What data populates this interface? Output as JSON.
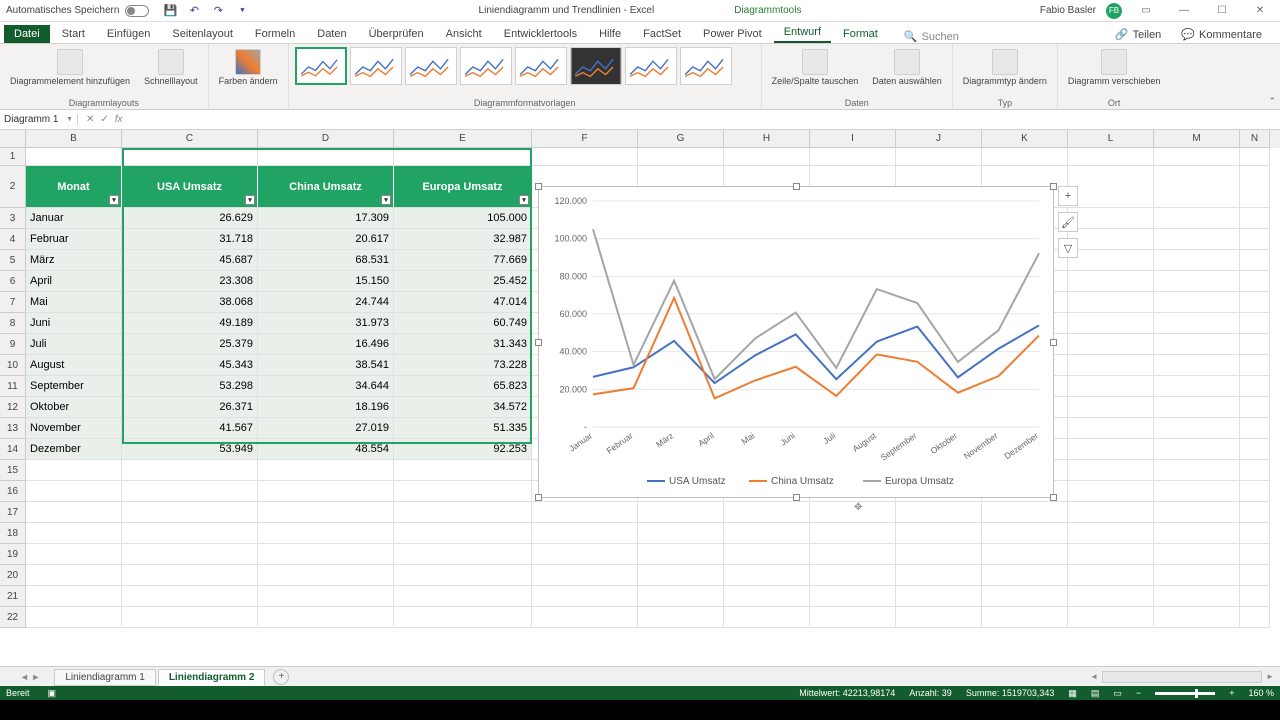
{
  "titlebar": {
    "autosave": "Automatisches Speichern",
    "doc_title": "Liniendiagramm und Trendlinien - Excel",
    "context_tools": "Diagrammtools",
    "user": "Fabio Basler",
    "user_initials": "FB"
  },
  "tabs": {
    "file": "Datei",
    "items": [
      "Start",
      "Einfügen",
      "Seitenlayout",
      "Formeln",
      "Daten",
      "Überprüfen",
      "Ansicht",
      "Entwicklertools",
      "Hilfe",
      "FactSet",
      "Power Pivot"
    ],
    "context": [
      "Entwurf",
      "Format"
    ],
    "active": "Entwurf",
    "search_placeholder": "Suchen",
    "share": "Teilen",
    "comments": "Kommentare"
  },
  "ribbon": {
    "g1": {
      "btn1": "Diagrammelement hinzufügen",
      "btn2": "Schnelllayout",
      "label": "Diagrammlayouts"
    },
    "g2": {
      "btn1": "Farben ändern"
    },
    "g3": {
      "label": "Diagrammformatvorlagen"
    },
    "g4": {
      "btn1": "Zeile/Spalte tauschen",
      "btn2": "Daten auswählen",
      "label": "Daten"
    },
    "g5": {
      "btn1": "Diagrammtyp ändern",
      "label": "Typ"
    },
    "g6": {
      "btn1": "Diagramm verschieben",
      "label": "Ort"
    }
  },
  "namebox": "Diagramm 1",
  "columns": [
    "B",
    "C",
    "D",
    "E",
    "F",
    "G",
    "H",
    "I",
    "J",
    "K",
    "L",
    "M",
    "N"
  ],
  "table": {
    "headers": [
      "Monat",
      "USA Umsatz",
      "China Umsatz",
      "Europa Umsatz"
    ],
    "rows": [
      [
        "Januar",
        "26.629",
        "17.309",
        "105.000"
      ],
      [
        "Februar",
        "31.718",
        "20.617",
        "32.987"
      ],
      [
        "März",
        "45.687",
        "68.531",
        "77.669"
      ],
      [
        "April",
        "23.308",
        "15.150",
        "25.452"
      ],
      [
        "Mai",
        "38.068",
        "24.744",
        "47.014"
      ],
      [
        "Juni",
        "49.189",
        "31.973",
        "60.749"
      ],
      [
        "Juli",
        "25.379",
        "16.496",
        "31.343"
      ],
      [
        "August",
        "45.343",
        "38.541",
        "73.228"
      ],
      [
        "September",
        "53.298",
        "34.644",
        "65.823"
      ],
      [
        "Oktober",
        "26.371",
        "18.196",
        "34.572"
      ],
      [
        "November",
        "41.567",
        "27.019",
        "51.335"
      ],
      [
        "Dezember",
        "53.949",
        "48.554",
        "92.253"
      ]
    ]
  },
  "chart_data": {
    "type": "line",
    "categories": [
      "Januar",
      "Februar",
      "März",
      "April",
      "Mai",
      "Juni",
      "Juli",
      "August",
      "September",
      "Oktober",
      "November",
      "Dezember"
    ],
    "series": [
      {
        "name": "USA Umsatz",
        "color": "#4472C4",
        "values": [
          26629,
          31718,
          45687,
          23308,
          38068,
          49189,
          25379,
          45343,
          53298,
          26371,
          41567,
          53949
        ]
      },
      {
        "name": "China Umsatz",
        "color": "#ED7D31",
        "values": [
          17309,
          20617,
          68531,
          15150,
          24744,
          31973,
          16496,
          38541,
          34644,
          18196,
          27019,
          48554
        ]
      },
      {
        "name": "Europa Umsatz",
        "color": "#A5A5A5",
        "values": [
          105000,
          32987,
          77669,
          25452,
          47014,
          60749,
          31343,
          73228,
          65823,
          34572,
          51335,
          92253
        ]
      }
    ],
    "ylim": [
      0,
      120000
    ],
    "yticks": [
      "-",
      "20.000",
      "40.000",
      "60.000",
      "80.000",
      "100.000",
      "120.000"
    ]
  },
  "sheets": {
    "tabs": [
      "Liniendiagramm 1",
      "Liniendiagramm 2"
    ],
    "active": 1
  },
  "statusbar": {
    "ready": "Bereit",
    "avg": "Mittelwert: 42213,98174",
    "count": "Anzahl: 39",
    "sum": "Summe: 1519703,343",
    "zoom": "160 %"
  }
}
